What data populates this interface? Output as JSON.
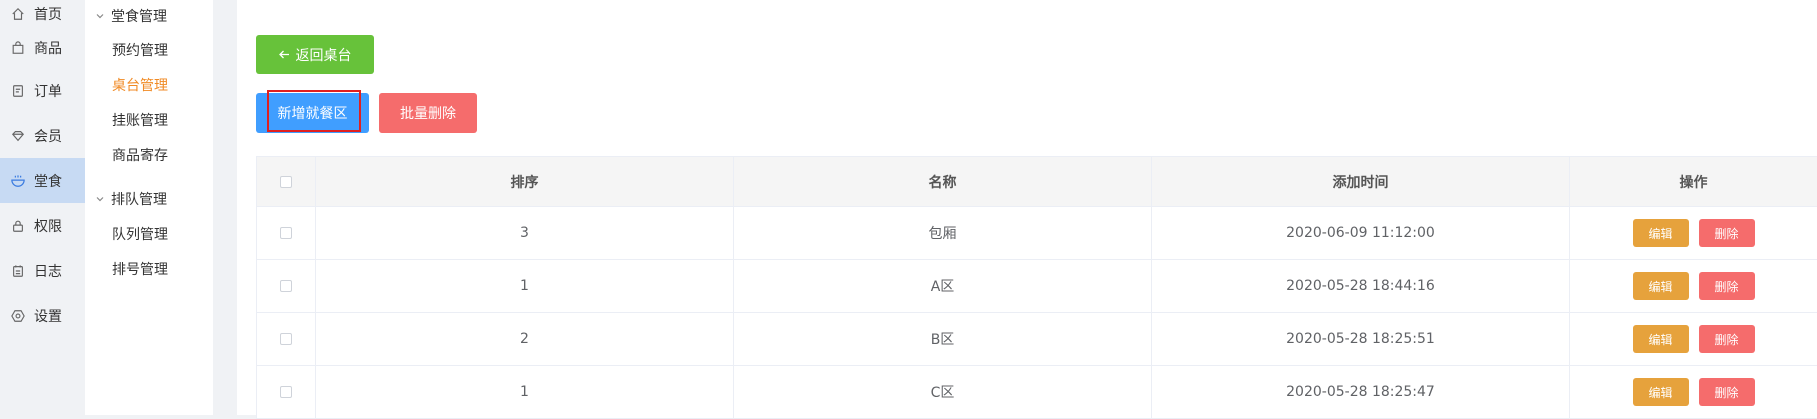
{
  "nav_primary": [
    {
      "label": "首页",
      "icon": "home-icon"
    },
    {
      "label": "商品",
      "icon": "shopping-bag-icon"
    },
    {
      "label": "订单",
      "icon": "order-icon"
    },
    {
      "label": "会员",
      "icon": "diamond-icon"
    },
    {
      "label": "堂食",
      "icon": "dine-in-icon",
      "active": true
    },
    {
      "label": "权限",
      "icon": "lock-icon"
    },
    {
      "label": "日志",
      "icon": "calendar-icon"
    },
    {
      "label": "设置",
      "icon": "settings-icon"
    }
  ],
  "nav_secondary": {
    "groups": [
      {
        "title": "堂食管理",
        "items": [
          {
            "label": "预约管理"
          },
          {
            "label": "桌台管理",
            "active": true
          },
          {
            "label": "挂账管理"
          },
          {
            "label": "商品寄存"
          }
        ]
      },
      {
        "title": "排队管理",
        "items": [
          {
            "label": "队列管理"
          },
          {
            "label": "排号管理"
          }
        ]
      }
    ]
  },
  "toolbar": {
    "back_label": "返回桌台",
    "add_label": "新增就餐区",
    "batch_delete_label": "批量删除"
  },
  "table": {
    "columns": [
      "排序",
      "名称",
      "添加时间",
      "操作"
    ],
    "action_edit": "编辑",
    "action_delete": "删除",
    "rows": [
      {
        "order": "3",
        "name": "包厢",
        "time": "2020-06-09 11:12:00"
      },
      {
        "order": "1",
        "name": "A区",
        "time": "2020-05-28 18:44:16"
      },
      {
        "order": "2",
        "name": "B区",
        "time": "2020-05-28 18:25:51"
      },
      {
        "order": "1",
        "name": "C区",
        "time": "2020-05-28 18:25:47"
      }
    ]
  },
  "colors": {
    "back_button": "#67c23a",
    "primary_button": "#409eff",
    "danger_button": "#f56c6c",
    "edit_button": "#e6a23c",
    "active_nav_bg": "#c7daf3",
    "active_subnav_text": "#f08a24",
    "highlight_box": "#e02020"
  }
}
